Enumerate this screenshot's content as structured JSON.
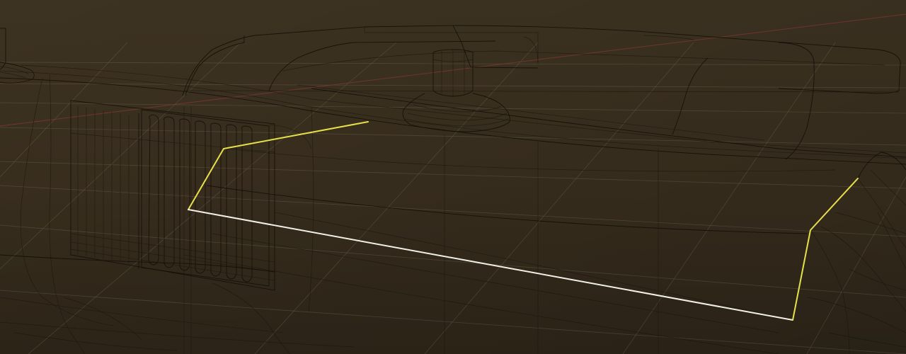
{
  "viewport": {
    "background_top": "#3d3322",
    "background_bottom": "#2f2719",
    "grid_color": "#6a604e",
    "x_axis_color": "#8a3a34",
    "wire_color": "#141008",
    "selected_edge_color": "#e6e04a",
    "active_edge_color": "#f2f0e6",
    "mode": "edit",
    "shading": "wireframe"
  }
}
